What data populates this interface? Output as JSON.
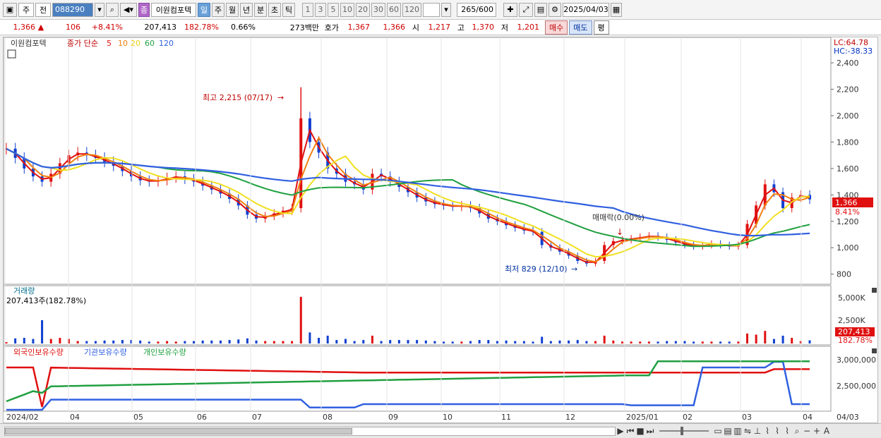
{
  "toolbar": {
    "mode": "주",
    "prev": "전",
    "code": "088290",
    "stock_badge": "종",
    "stock_name": "이원컴포텍",
    "periods": [
      "일",
      "주",
      "월",
      "년",
      "분",
      "초",
      "틱"
    ],
    "active_period": "일",
    "intervals": [
      "1",
      "3",
      "5",
      "10",
      "20",
      "30",
      "60",
      "120"
    ],
    "count": "265",
    "count_max": "/600",
    "date": "2025/04/03"
  },
  "quote": {
    "price": "1,366",
    "change": "106",
    "change_pct": "+8.41%",
    "volume": "207,413",
    "volume_pct": "182.78%",
    "turnover": "0.66%",
    "amount": "273백만",
    "quote_label": "호가",
    "ask": "1,367",
    "bid": "1,366",
    "open_label": "시",
    "open": "1,217",
    "high_label": "고",
    "high": "1,370",
    "low_label": "저",
    "low": "1,201",
    "buy_btn": "매수",
    "sell_btn": "매도",
    "eval_btn": "평"
  },
  "price_legend": {
    "name": "이원컴포텍",
    "ma_label": "종가 단순",
    "ma": [
      {
        "period": "5",
        "color": "#e01010"
      },
      {
        "period": "10",
        "color": "#f08010"
      },
      {
        "period": "20",
        "color": "#f0e020"
      },
      {
        "period": "60",
        "color": "#20a040"
      },
      {
        "period": "120",
        "color": "#3060e0"
      }
    ]
  },
  "lc_label": "LC:64.78",
  "hc_label": "HC:-38.33",
  "price_axis": [
    "2,400",
    "2,200",
    "2,000",
    "1,800",
    "1,600",
    "1,400",
    "1,200",
    "1,000",
    "800"
  ],
  "current_price_tag": "1,366",
  "current_pct_tag": "8.41%",
  "annotations": {
    "high": "최고 2,215 (07/17)",
    "low": "최저 829 (12/10)",
    "event": "매매락(0.00%)"
  },
  "volume_panel": {
    "title": "거래량",
    "value": "207,413주(182.78%)",
    "axis": [
      "5,000K",
      "2,500K"
    ],
    "tag1": "207,413",
    "tag2": "182.78%"
  },
  "holdings_panel": {
    "legend": [
      {
        "name": "외국인보유수량",
        "color": "#e01010"
      },
      {
        "name": "기관보유수량",
        "color": "#3060e0"
      },
      {
        "name": "개인보유수량",
        "color": "#20a040"
      }
    ],
    "axis": [
      "3,000,000",
      "2,500,000"
    ]
  },
  "date_axis": [
    "2024/02",
    "04",
    "05",
    "06",
    "07",
    "08",
    "09",
    "10",
    "11",
    "12",
    "2025/01",
    "02",
    "03",
    "04"
  ],
  "date_axis_right": "04/03",
  "chart_data": {
    "type": "line",
    "price_range": [
      750,
      2550
    ],
    "key_points": {
      "high": 2215,
      "high_date": "07/17",
      "low": 829,
      "low_date": "12/10",
      "last": 1366
    },
    "close": [
      1750,
      1680,
      1600,
      1540,
      1500,
      1560,
      1640,
      1700,
      1720,
      1700,
      1680,
      1650,
      1620,
      1580,
      1540,
      1510,
      1500,
      1510,
      1530,
      1540,
      1520,
      1500,
      1470,
      1440,
      1410,
      1370,
      1320,
      1250,
      1220,
      1240,
      1260,
      1280,
      1300,
      1980,
      1800,
      1720,
      1600,
      1560,
      1500,
      1480,
      1440,
      1560,
      1540,
      1500,
      1460,
      1420,
      1380,
      1350,
      1330,
      1320,
      1310,
      1320,
      1300,
      1260,
      1220,
      1200,
      1170,
      1150,
      1130,
      1120,
      1020,
      1000,
      970,
      940,
      900,
      880,
      900,
      1020,
      1050,
      1060,
      1070,
      1080,
      1090,
      1080,
      1060,
      1040,
      1020,
      1010,
      1020,
      1030,
      1020,
      1010,
      1020,
      1180,
      1320,
      1480,
      1420,
      1300,
      1380,
      1400,
      1366
    ]
  }
}
